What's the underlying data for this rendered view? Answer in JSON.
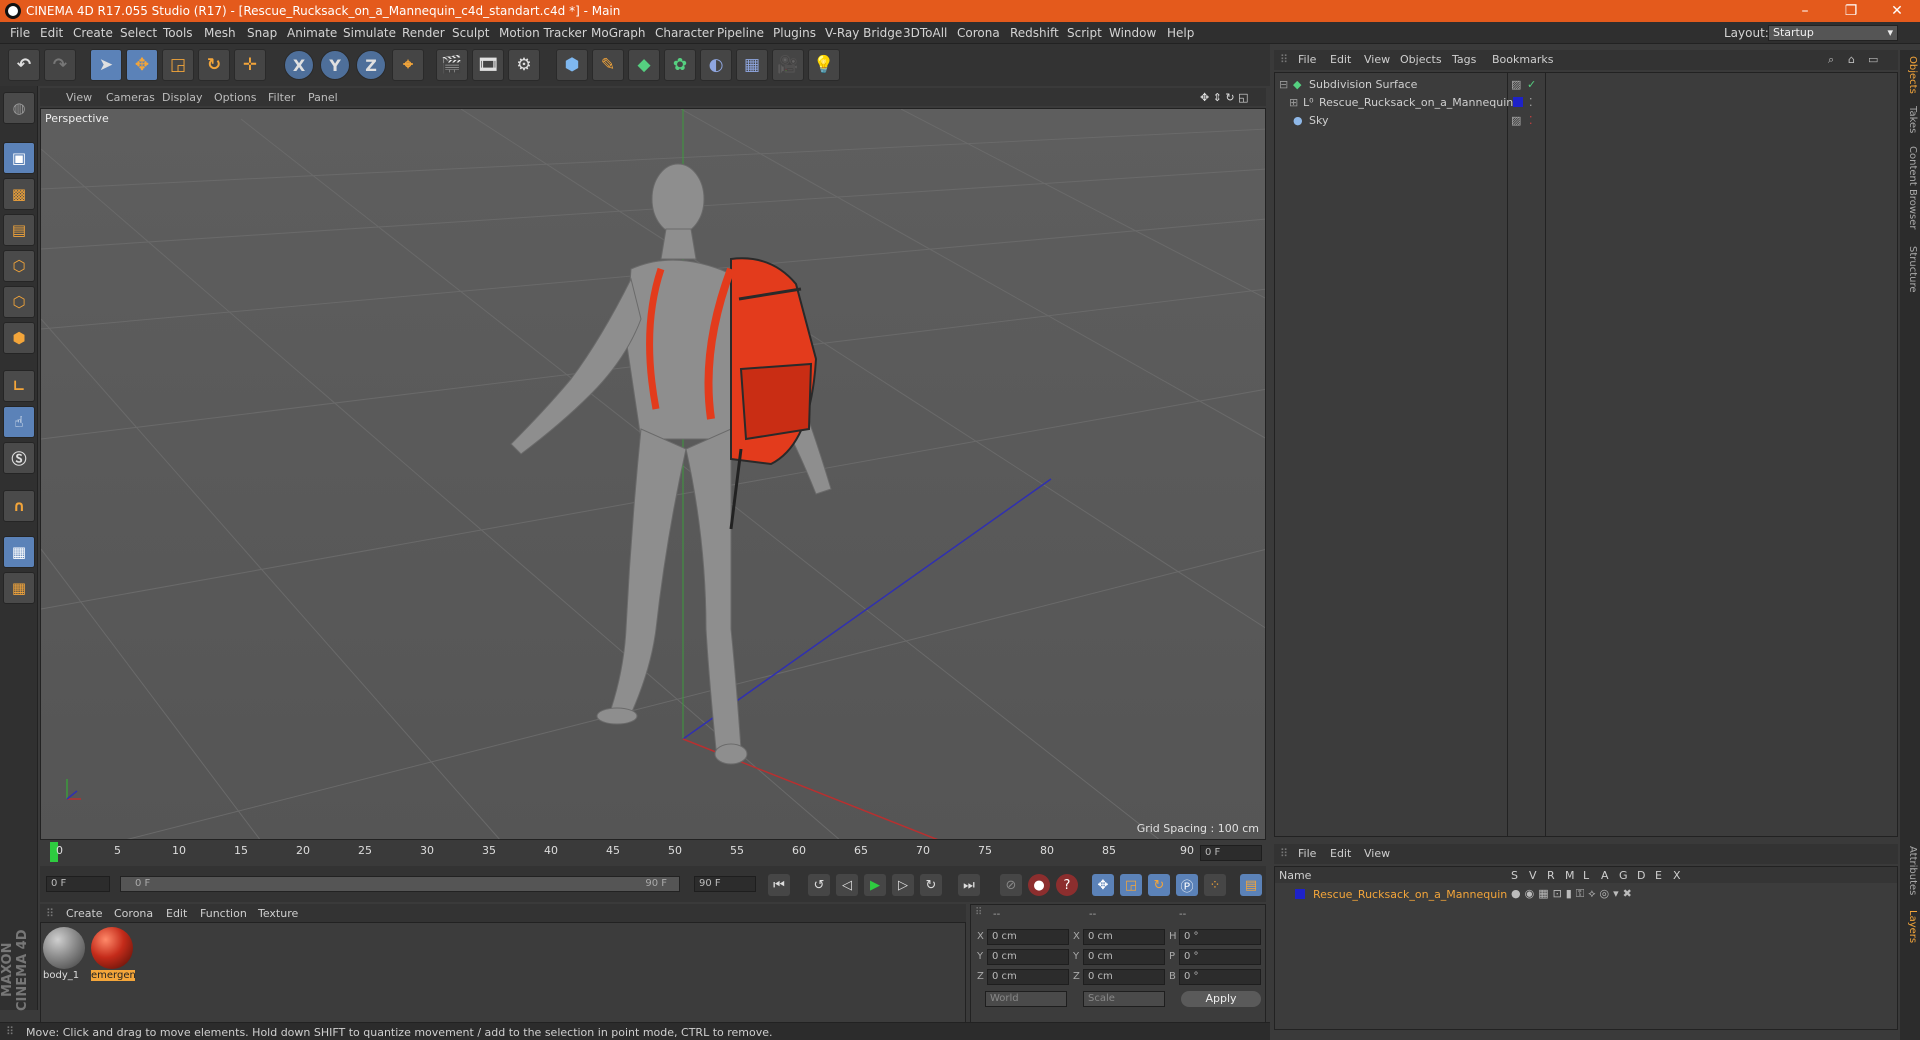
{
  "window": {
    "title": "CINEMA 4D R17.055 Studio (R17) - [Rescue_Rucksack_on_a_Mannequin_c4d_standart.c4d *] - Main",
    "controls": [
      "–",
      "❐",
      "✕"
    ]
  },
  "menu": [
    "File",
    "Edit",
    "Create",
    "Select",
    "Tools",
    "Mesh",
    "Snap",
    "Animate",
    "Simulate",
    "Render",
    "Sculpt",
    "Motion Tracker",
    "MoGraph",
    "Character",
    "Pipeline",
    "Plugins",
    "V-Ray Bridge",
    "3DToAll",
    "Corona",
    "Redshift",
    "Script",
    "Window",
    "Help"
  ],
  "layout": {
    "label": "Layout:",
    "value": "Startup"
  },
  "viewport": {
    "menu": [
      "View",
      "Cameras",
      "Display",
      "Options",
      "Filter",
      "Panel"
    ],
    "camera_label": "Perspective",
    "grid_spacing": "Grid Spacing : 100 cm"
  },
  "object_manager": {
    "menu": [
      "File",
      "Edit",
      "View",
      "Objects",
      "Tags",
      "Bookmarks"
    ],
    "objects": [
      {
        "name": "Subdivision Surface"
      },
      {
        "name": "Rescue_Rucksack_on_a_Mannequin"
      },
      {
        "name": "Sky"
      }
    ]
  },
  "side_tabs": [
    "Objects",
    "Takes",
    "Content Browser",
    "Structure",
    "Attributes",
    "Layers"
  ],
  "timeline": {
    "ticks": [
      "0",
      "5",
      "10",
      "15",
      "20",
      "25",
      "30",
      "35",
      "40",
      "45",
      "50",
      "55",
      "60",
      "65",
      "70",
      "75",
      "80",
      "85",
      "90"
    ],
    "current_frame": "0 F",
    "start_field": "0 F",
    "range_start": "0 F",
    "range_end": "90 F",
    "end_field": "90 F"
  },
  "material_manager": {
    "menu": [
      "Create",
      "Corona",
      "Edit",
      "Function",
      "Texture"
    ],
    "materials": [
      {
        "name": "body_1",
        "color": "#8a8a8a",
        "selected": false
      },
      {
        "name": "emergen",
        "color": "#c42b1a",
        "selected": true
      }
    ]
  },
  "coordinates": {
    "header": [
      "--",
      "--",
      "--"
    ],
    "rows": [
      {
        "a": "X",
        "av": "0 cm",
        "b": "X",
        "bv": "0 cm",
        "c": "H",
        "cv": "0 °"
      },
      {
        "a": "Y",
        "av": "0 cm",
        "b": "Y",
        "bv": "0 cm",
        "c": "P",
        "cv": "0 °"
      },
      {
        "a": "Z",
        "av": "0 cm",
        "b": "Z",
        "bv": "0 cm",
        "c": "B",
        "cv": "0 °"
      }
    ],
    "mode1": "World",
    "mode2": "Scale",
    "apply": "Apply"
  },
  "layers": {
    "menu": [
      "File",
      "Edit",
      "View"
    ],
    "columns": [
      "Name",
      "S",
      "V",
      "R",
      "M",
      "L",
      "A",
      "G",
      "D",
      "E",
      "X"
    ],
    "items": [
      {
        "name": "Rescue_Rucksack_on_a_Mannequin",
        "color": "#1e22c8"
      }
    ]
  },
  "status": "Move: Click and drag to move elements. Hold down SHIFT to quantize movement / add to the selection in point mode, CTRL to remove.",
  "brand": "MAXON CINEMA 4D",
  "accent": "#e45a1c"
}
